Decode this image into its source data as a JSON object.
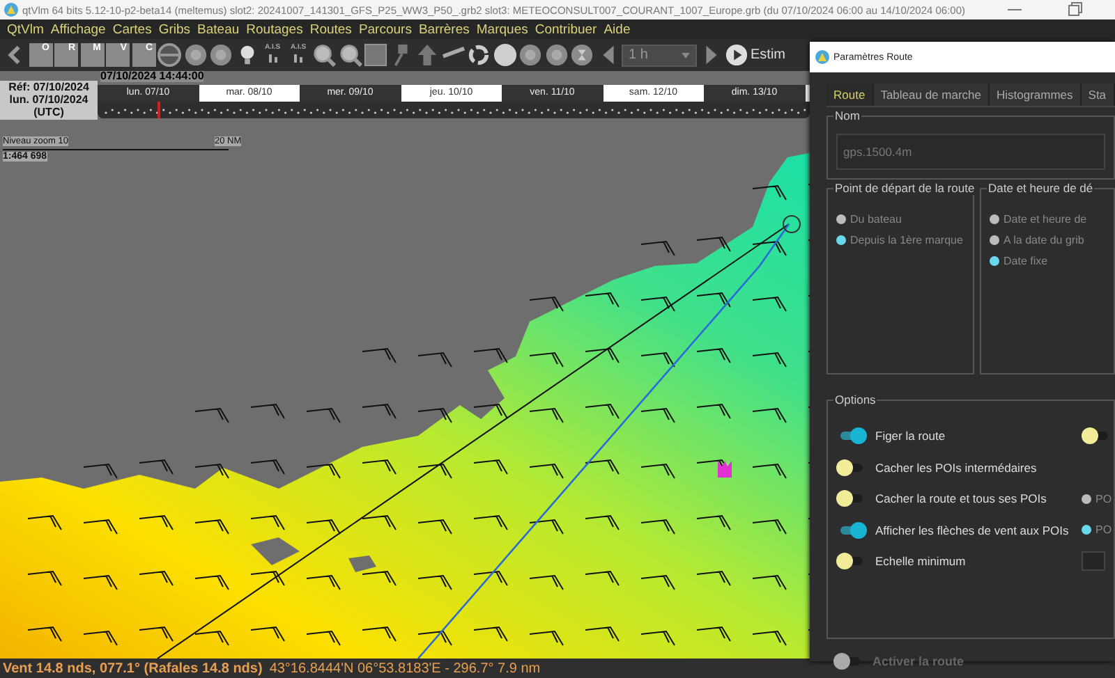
{
  "window": {
    "title": "qtVlm 64 bits 5.12-10-p2-beta14 (meltemus) slot2: 20241007_141301_GFS_P25_WW3_P50_.grb2 slot3: METEOCONSULT007_COURANT_1007_Europe.grb (du 07/10/2024 06:00 au 14/10/2024 06:00)"
  },
  "menu": [
    "QtVlm",
    "Affichage",
    "Cartes",
    "Gribs",
    "Bateau",
    "Routages",
    "Routes",
    "Parcours",
    "Barrères",
    "Marques",
    "Contribuer",
    "Aide"
  ],
  "toolbar": [
    {
      "kind": "back"
    },
    {
      "kind": "tile",
      "label": "O"
    },
    {
      "kind": "tile",
      "label": "R"
    },
    {
      "kind": "tile",
      "label": "M"
    },
    {
      "kind": "tile",
      "label": "V"
    },
    {
      "kind": "tile",
      "label": "C"
    },
    {
      "kind": "slash"
    },
    {
      "kind": "disc"
    },
    {
      "kind": "disc"
    },
    {
      "kind": "bulb"
    },
    {
      "kind": "ais",
      "label": "A.I.S"
    },
    {
      "kind": "ais",
      "label": "A.I.S"
    },
    {
      "kind": "magnifier"
    },
    {
      "kind": "magnifier"
    },
    {
      "kind": "square"
    },
    {
      "kind": "pen"
    },
    {
      "kind": "arrow"
    },
    {
      "kind": "ruler"
    },
    {
      "kind": "refresh"
    },
    {
      "kind": "sphere"
    },
    {
      "kind": "disc"
    },
    {
      "kind": "disc"
    },
    {
      "kind": "hourglass"
    },
    {
      "kind": "prev"
    },
    {
      "kind": "combo",
      "value": "1 h"
    },
    {
      "kind": "next"
    },
    {
      "kind": "play"
    },
    {
      "kind": "text",
      "label": "Estim"
    }
  ],
  "timeline": {
    "now": "07/10/2024 14:44:00",
    "ref": "Réf: 07/10/2024",
    "date": "lun. 07/10/2024",
    "zone": "(UTC)",
    "days": [
      {
        "label": "lun. 07/10",
        "light": false
      },
      {
        "label": "mar. 08/10",
        "light": true
      },
      {
        "label": "mer. 09/10",
        "light": false
      },
      {
        "label": "jeu. 10/10",
        "light": true
      },
      {
        "label": "ven. 11/10",
        "light": false
      },
      {
        "label": "sam. 12/10",
        "light": true
      },
      {
        "label": "dim. 13/10",
        "light": false
      }
    ]
  },
  "scale": {
    "zoom": "Niveau zoom 10",
    "distance": "20 NM",
    "ratio": "1:464 698"
  },
  "status_bar": {
    "wind": "Vent 14.8 nds, 077.1° (Rafales 14.8 nds)",
    "position": "43°16.8444'N 06°53.8183'E - 296.7° 7.9 nm"
  },
  "dialog": {
    "title": "Paramètres Route",
    "tabs": [
      {
        "label": "Route",
        "selected": true
      },
      {
        "label": "Tableau de marche",
        "selected": false
      },
      {
        "label": "Histogrammes",
        "selected": false
      },
      {
        "label": "Sta",
        "selected": false
      }
    ],
    "name_group": {
      "title": "Nom",
      "value": "gps.1500.4m"
    },
    "start_group": {
      "title": "Point de départ de la route",
      "options": [
        {
          "label": "Du bateau",
          "selected": false
        },
        {
          "label": "Depuis la 1ère marque",
          "selected": true
        }
      ]
    },
    "date_group": {
      "title": "Date et heure de dé",
      "options": [
        {
          "label": "Date et heure de",
          "selected": false
        },
        {
          "label": "A la date du grib",
          "selected": false
        },
        {
          "label": "Date fixe",
          "selected": true
        }
      ]
    },
    "options_group": {
      "title": "Options",
      "rows": [
        {
          "label": "Figer la route",
          "on": true,
          "extra": {
            "kind": "toggle",
            "on": false
          }
        },
        {
          "label": "Cacher les POIs intermédaires",
          "on": false
        },
        {
          "label": "Cacher la route et tous ses POIs",
          "on": false,
          "extra": {
            "kind": "radio",
            "label": "PO",
            "selected": false
          }
        },
        {
          "label": "Afficher les flèches de vent aux POIs",
          "on": true,
          "extra": {
            "kind": "radio",
            "label": "PO",
            "selected": true
          }
        },
        {
          "label": "Echelle minimum",
          "on": false,
          "extra": {
            "kind": "field"
          }
        }
      ]
    },
    "activate": {
      "label": "Activer la route",
      "on": false,
      "disabled": true
    }
  }
}
